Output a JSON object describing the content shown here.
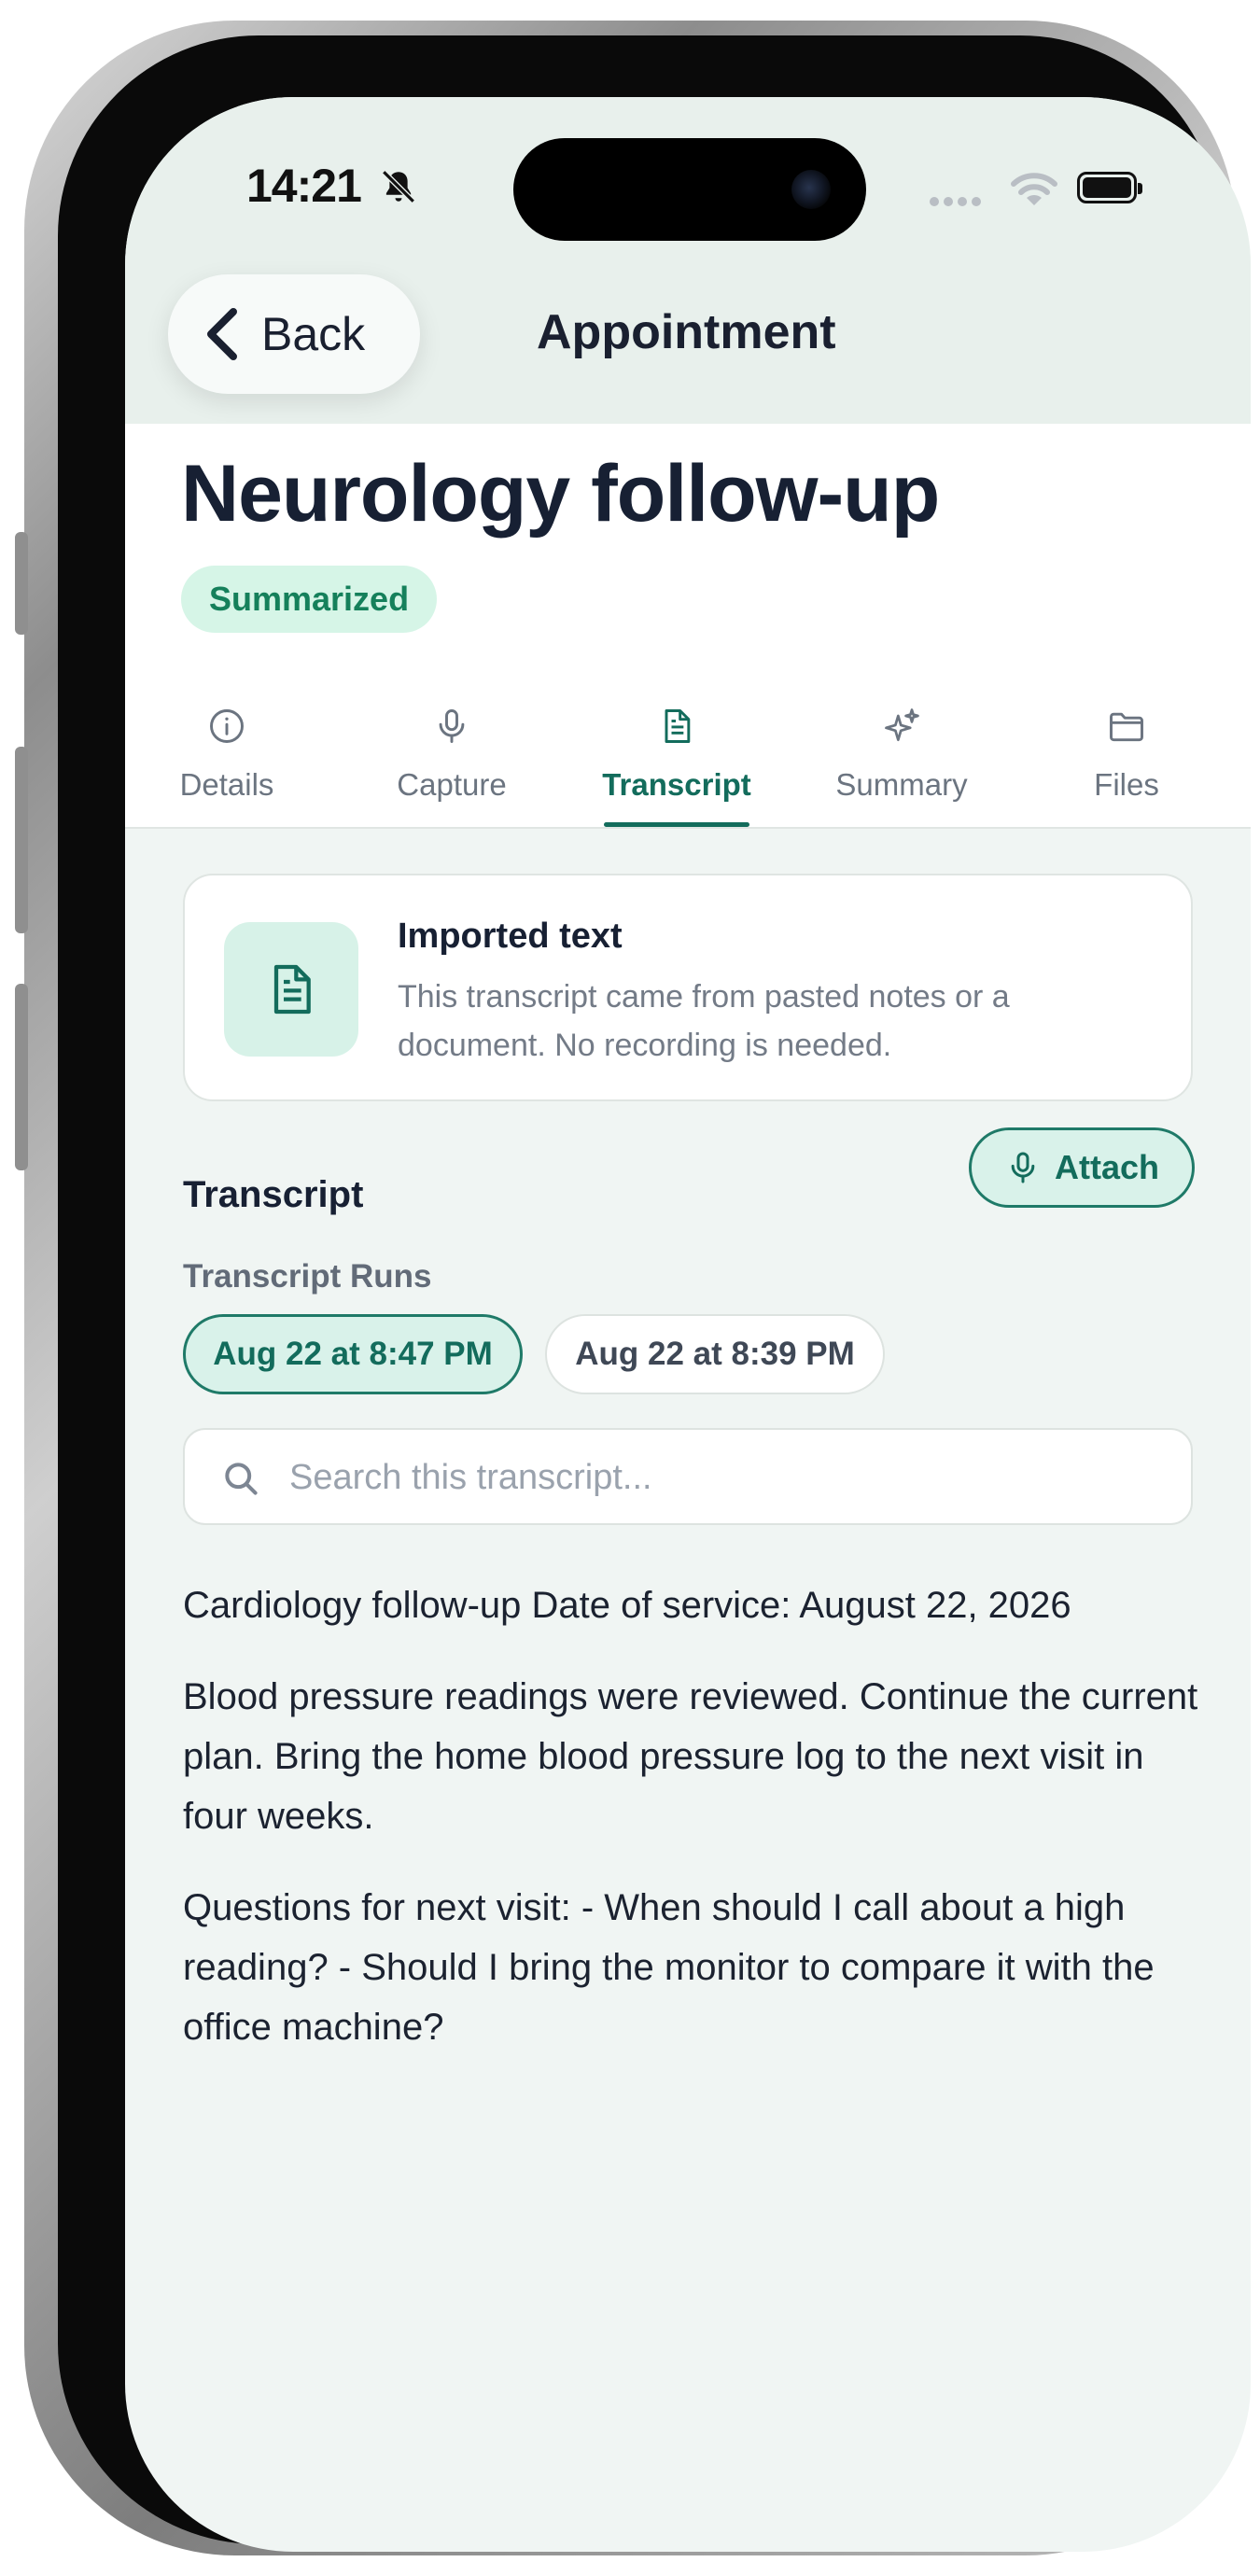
{
  "status_bar": {
    "time": "14:21"
  },
  "nav": {
    "back_label": "Back",
    "title": "Appointment"
  },
  "appointment": {
    "title": "Neurology follow-up",
    "status": "Summarized"
  },
  "tabs": [
    {
      "label": "Details",
      "icon": "info-circle-icon"
    },
    {
      "label": "Capture",
      "icon": "microphone-icon"
    },
    {
      "label": "Transcript",
      "icon": "document-icon",
      "active": true
    },
    {
      "label": "Summary",
      "icon": "sparkles-icon"
    },
    {
      "label": "Files",
      "icon": "folder-icon"
    }
  ],
  "info_card": {
    "title": "Imported text",
    "description": "This transcript came from pasted notes or a document. No recording is needed."
  },
  "transcript_section": {
    "title": "Transcript",
    "attach_label": "Attach",
    "runs_label": "Transcript Runs",
    "runs": [
      {
        "label": "Aug 22 at 8:47 PM",
        "selected": true
      },
      {
        "label": "Aug 22 at 8:39 PM",
        "selected": false
      }
    ],
    "search_placeholder": "Search this transcript...",
    "paragraphs": [
      "Cardiology follow-up Date of service: August 22, 2026",
      "Blood pressure readings were reviewed. Continue the current plan. Bring the home blood pressure log to the next visit in four weeks.",
      "Questions for next visit: - When should I call about a high reading? - Should I bring the monitor to compare it with the office machine?"
    ]
  },
  "colors": {
    "accent": "#136c5c",
    "badge_bg": "#d6f5e7",
    "screen_bg": "#f0f5f3"
  }
}
